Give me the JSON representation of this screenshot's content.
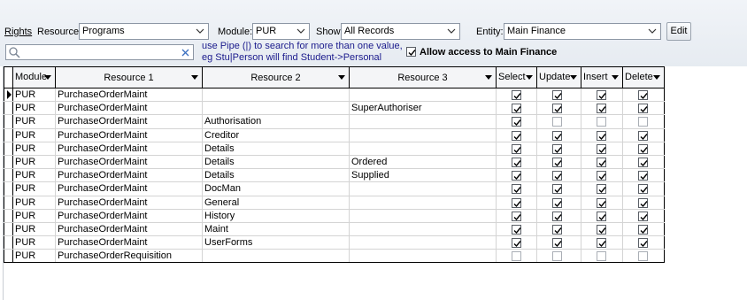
{
  "toolbar": {
    "rights_label": "Rights",
    "resource_label": "Resource:",
    "resource_value": "Programs",
    "module_label": "Module:",
    "module_value": "PUR",
    "show_label": "Show:",
    "show_value": "All Records",
    "entity_label": "Entity:",
    "entity_value": "Main Finance",
    "edit_label": "Edit",
    "search_value": "",
    "search_hint_line1": "use Pipe (|) to search for more than one value,",
    "search_hint_line2": "eg Stu|Person will find Student->Personal",
    "allow_access_label": "Allow access to Main Finance",
    "allow_access_checked": true
  },
  "grid": {
    "columns": [
      "Module",
      "Resource 1",
      "Resource 2",
      "Resource 3",
      "Select",
      "Update",
      "Insert",
      "Delete"
    ],
    "rows": [
      {
        "module": "PUR",
        "r1": "PurchaseOrderMaint",
        "r2": "",
        "r3": "",
        "select": true,
        "update": true,
        "insert": true,
        "delete": true
      },
      {
        "module": "PUR",
        "r1": "PurchaseOrderMaint",
        "r2": "",
        "r3": "SuperAuthoriser",
        "select": true,
        "update": true,
        "insert": true,
        "delete": true
      },
      {
        "module": "PUR",
        "r1": "PurchaseOrderMaint",
        "r2": "Authorisation",
        "r3": "",
        "select": true,
        "update": false,
        "insert": false,
        "delete": false
      },
      {
        "module": "PUR",
        "r1": "PurchaseOrderMaint",
        "r2": "Creditor",
        "r3": "",
        "select": true,
        "update": true,
        "insert": true,
        "delete": true
      },
      {
        "module": "PUR",
        "r1": "PurchaseOrderMaint",
        "r2": "Details",
        "r3": "",
        "select": true,
        "update": true,
        "insert": true,
        "delete": true
      },
      {
        "module": "PUR",
        "r1": "PurchaseOrderMaint",
        "r2": "Details",
        "r3": "Ordered",
        "select": true,
        "update": true,
        "insert": true,
        "delete": true
      },
      {
        "module": "PUR",
        "r1": "PurchaseOrderMaint",
        "r2": "Details",
        "r3": "Supplied",
        "select": true,
        "update": true,
        "insert": true,
        "delete": true
      },
      {
        "module": "PUR",
        "r1": "PurchaseOrderMaint",
        "r2": "DocMan",
        "r3": "",
        "select": true,
        "update": true,
        "insert": true,
        "delete": true
      },
      {
        "module": "PUR",
        "r1": "PurchaseOrderMaint",
        "r2": "General",
        "r3": "",
        "select": true,
        "update": true,
        "insert": true,
        "delete": true
      },
      {
        "module": "PUR",
        "r1": "PurchaseOrderMaint",
        "r2": "History",
        "r3": "",
        "select": true,
        "update": true,
        "insert": true,
        "delete": true
      },
      {
        "module": "PUR",
        "r1": "PurchaseOrderMaint",
        "r2": "Maint",
        "r3": "",
        "select": true,
        "update": true,
        "insert": true,
        "delete": true
      },
      {
        "module": "PUR",
        "r1": "PurchaseOrderMaint",
        "r2": "UserForms",
        "r3": "",
        "select": true,
        "update": true,
        "insert": true,
        "delete": true
      },
      {
        "module": "PUR",
        "r1": "PurchaseOrderRequisition",
        "r2": "",
        "r3": "",
        "select": false,
        "update": false,
        "insert": false,
        "delete": false
      }
    ]
  }
}
